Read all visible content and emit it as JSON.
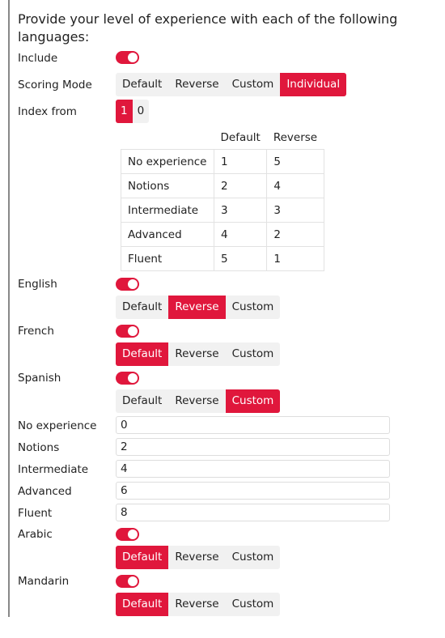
{
  "question": "Provide your level of experience with each of the following languages:",
  "colors": {
    "accent": "#e0173c",
    "segment_bg": "#f1f1f1"
  },
  "include": {
    "label": "Include",
    "on": true
  },
  "scoring_mode": {
    "label": "Scoring Mode",
    "options": [
      "Default",
      "Reverse",
      "Custom",
      "Individual"
    ],
    "selected": "Individual"
  },
  "index_from": {
    "label": "Index from",
    "options": [
      "1",
      "0"
    ],
    "selected": "1"
  },
  "score_table": {
    "headers": [
      "Default",
      "Reverse"
    ],
    "rows": [
      {
        "label": "No experience",
        "default": "1",
        "reverse": "5"
      },
      {
        "label": "Notions",
        "default": "2",
        "reverse": "4"
      },
      {
        "label": "Intermediate",
        "default": "3",
        "reverse": "3"
      },
      {
        "label": "Advanced",
        "default": "4",
        "reverse": "2"
      },
      {
        "label": "Fluent",
        "default": "5",
        "reverse": "1"
      }
    ]
  },
  "languages": [
    {
      "name": "English",
      "on": true,
      "options": [
        "Default",
        "Reverse",
        "Custom"
      ],
      "selected": "Reverse"
    },
    {
      "name": "French",
      "on": true,
      "options": [
        "Default",
        "Reverse",
        "Custom"
      ],
      "selected": "Default"
    },
    {
      "name": "Spanish",
      "on": true,
      "options": [
        "Default",
        "Reverse",
        "Custom"
      ],
      "selected": "Custom",
      "custom_values": [
        {
          "label": "No experience",
          "value": "0"
        },
        {
          "label": "Notions",
          "value": "2"
        },
        {
          "label": "Intermediate",
          "value": "4"
        },
        {
          "label": "Advanced",
          "value": "6"
        },
        {
          "label": "Fluent",
          "value": "8"
        }
      ]
    },
    {
      "name": "Arabic",
      "on": true,
      "options": [
        "Default",
        "Reverse",
        "Custom"
      ],
      "selected": "Default"
    },
    {
      "name": "Mandarin",
      "on": true,
      "options": [
        "Default",
        "Reverse",
        "Custom"
      ],
      "selected": "Default"
    }
  ]
}
